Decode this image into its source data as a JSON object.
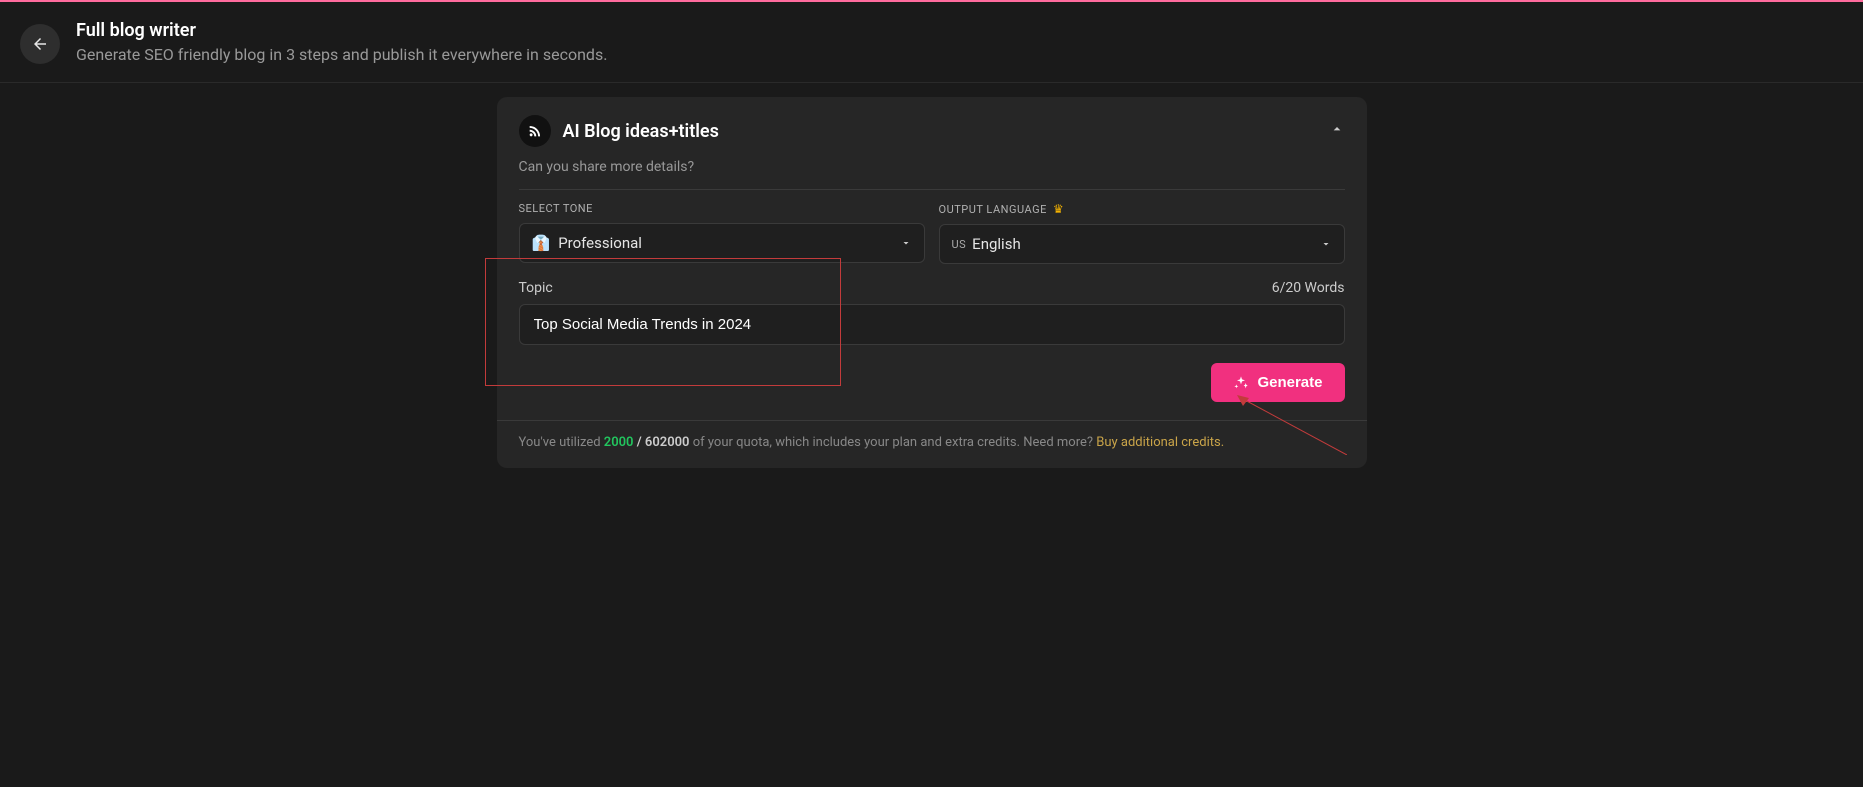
{
  "header": {
    "title": "Full blog writer",
    "subtitle": "Generate SEO friendly blog in 3 steps and publish it everywhere in seconds."
  },
  "card": {
    "title": "AI Blog ideas+titles",
    "subtitle": "Can you share more details?"
  },
  "tone": {
    "label": "SELECT TONE",
    "emoji": "👔",
    "value": "Professional"
  },
  "lang": {
    "label": "OUTPUT LANGUAGE",
    "prefix": "US",
    "value": "English"
  },
  "topic": {
    "label": "Topic",
    "counter": "6/20 Words",
    "value": "Top Social Media Trends in 2024"
  },
  "generate": {
    "label": "Generate"
  },
  "quota": {
    "prefix": "You've utilized ",
    "used": "2000",
    "sep": " / ",
    "total": "602000",
    "mid": " of your quota, which includes your plan and extra credits. Need more? ",
    "link": "Buy additional credits."
  }
}
